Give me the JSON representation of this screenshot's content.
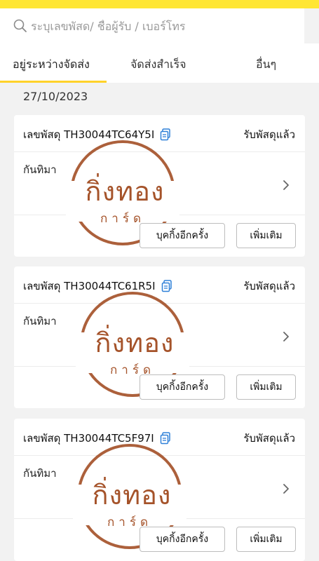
{
  "search": {
    "placeholder": "ระบุเลขพัสด/ ชื่อผู้รับ / เบอร์โทร"
  },
  "tabs": [
    {
      "label": "อยู่ระหว่างจัดส่ง",
      "active": true
    },
    {
      "label": "จัดส่งสำเร็จ",
      "active": false
    },
    {
      "label": "อื่นๆ",
      "active": false
    }
  ],
  "date": "27/10/2023",
  "colors": {
    "topbar": "#ffe633",
    "tab_underline": "#ffd22a",
    "stamp": "#a5532a",
    "copy_icon": "#2f80d8"
  },
  "stamp": {
    "big": "กิ่งทอง",
    "small": "การ์ด"
  },
  "cards": [
    {
      "tracking": "เลขพัสดุ TH30044TC64Y5I",
      "status": "รับพัสดุแล้ว",
      "recipient": "กันทิมา",
      "rebook_label": "บุคกิ้งอีกครั้ง",
      "more_label": "เพิ่มเติม"
    },
    {
      "tracking": "เลขพัสดุ TH30044TC61R5I",
      "status": "รับพัสดุแล้ว",
      "recipient": "กันทิมา",
      "rebook_label": "บุคกิ้งอีกครั้ง",
      "more_label": "เพิ่มเติม"
    },
    {
      "tracking": "เลขพัสดุ TH30044TC5F97I",
      "status": "รับพัสดุแล้ว",
      "recipient": "กันทิมา",
      "rebook_label": "บุคกิ้งอีกครั้ง",
      "more_label": "เพิ่มเติม"
    }
  ]
}
